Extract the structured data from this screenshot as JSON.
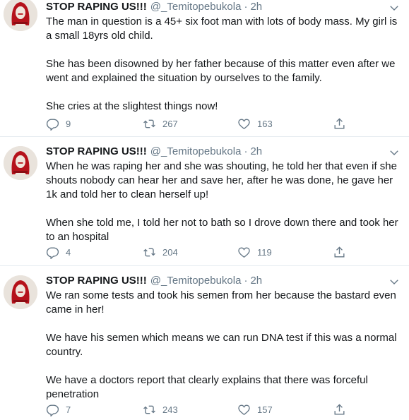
{
  "tweets": [
    {
      "name": "STOP RAPING US!!!",
      "handle": "@_Temitopebukola",
      "separator": "·",
      "time": "2h",
      "paragraphs": [
        "The man in question is a 45+ six foot man with lots of body mass. My girl is a small 18yrs old child.",
        "She has been disowned by her father because of this matter even after we went and explained the situation by ourselves to the family.",
        "She cries at the slightest things now!"
      ],
      "replies": "9",
      "retweets": "267",
      "likes": "163"
    },
    {
      "name": "STOP RAPING US!!!",
      "handle": "@_Temitopebukola",
      "separator": "·",
      "time": "2h",
      "paragraphs": [
        "When he was raping her and she was shouting, he told her that even if she shouts nobody can hear her and save her, after he was done, he gave her 1k and told her to clean herself up!",
        "When she told me, I told her not to bath so I drove down there and took her to an hospital"
      ],
      "replies": "4",
      "retweets": "204",
      "likes": "119"
    },
    {
      "name": "STOP RAPING US!!!",
      "handle": "@_Temitopebukola",
      "separator": "·",
      "time": "2h",
      "paragraphs": [
        "We ran some tests and took his semen from her because the bastard even came in her!",
        "We have his semen which means we can run DNA test if this was a normal country.",
        "We have a doctors report that clearly explains that there was forceful penetration"
      ],
      "replies": "7",
      "retweets": "243",
      "likes": "157"
    }
  ],
  "colors": {
    "text": "#14171a",
    "secondary": "#657786",
    "divider": "#e6ecf0",
    "avatar_bg": "#e9e3dc",
    "avatar_red": "#b5121b"
  },
  "icons": {
    "reply": "reply-icon",
    "retweet": "retweet-icon",
    "like": "heart-icon",
    "share": "share-icon",
    "more": "chevron-down-icon"
  }
}
